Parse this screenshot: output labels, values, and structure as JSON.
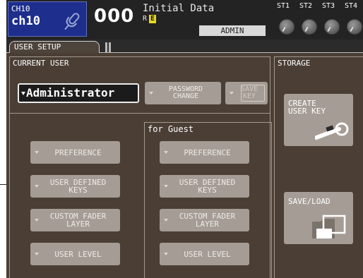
{
  "channel": {
    "number": "CH10",
    "name": "ch10",
    "icon": "microphone-icon"
  },
  "scene": {
    "number": "000",
    "title": "Initial Data",
    "flag_r": "R",
    "flag_e": "E"
  },
  "current_user_badge": "ADMIN",
  "stereo": {
    "labels": [
      "ST1",
      "ST2",
      "ST3",
      "ST4"
    ],
    "icon": "knob-icon"
  },
  "tab": {
    "label": "USER SETUP"
  },
  "current_user": {
    "title": "CURRENT USER",
    "selected_user": "Administrator",
    "password_change": "PASSWORD\nCHANGE",
    "save_key": "SAVE\nKEY",
    "buttons": [
      "PREFERENCE",
      "USER DEFINED\nKEYS",
      "CUSTOM FADER\nLAYER",
      "USER LEVEL"
    ]
  },
  "guest": {
    "title": "for Guest",
    "buttons": [
      "PREFERENCE",
      "USER DEFINED\nKEYS",
      "CUSTOM FADER\nLAYER",
      "USER LEVEL"
    ]
  },
  "storage": {
    "title": "STORAGE",
    "create_user_key": "CREATE\nUSER KEY",
    "create_icon": "key-icon",
    "save_load": "SAVE/LOAD",
    "save_load_icon": "folder-icon"
  },
  "colors": {
    "screen_bg": "#4a3e35",
    "button": "#a59d95",
    "channel_box": "#1d2e8c",
    "scene_flag": "#e8d820"
  }
}
